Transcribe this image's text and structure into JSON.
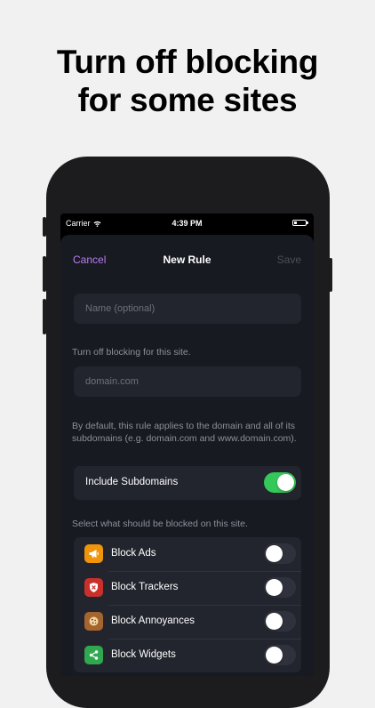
{
  "headline": {
    "line1": "Turn off blocking",
    "line2": "for some sites"
  },
  "statusbar": {
    "carrier": "Carrier",
    "time": "4:39 PM"
  },
  "navbar": {
    "cancel": "Cancel",
    "title": "New Rule",
    "save": "Save"
  },
  "name_field": {
    "placeholder": "Name (optional)"
  },
  "domain_section": {
    "label": "Turn off blocking for this site.",
    "placeholder": "domain.com",
    "explanation": "By default, this rule applies to the domain and all of its subdomains (e.g. domain.com and www.domain.com)."
  },
  "subdomains": {
    "label": "Include Subdomains",
    "enabled": true
  },
  "block_section": {
    "label": "Select what should be blocked on this site.",
    "items": [
      {
        "label": "Block Ads",
        "icon": "megaphone-icon",
        "color": "#f0940a",
        "enabled": false
      },
      {
        "label": "Block Trackers",
        "icon": "shield-icon",
        "color": "#c9302c",
        "enabled": false
      },
      {
        "label": "Block Annoyances",
        "icon": "cookie-icon",
        "color": "#a5652f",
        "enabled": false
      },
      {
        "label": "Block Widgets",
        "icon": "share-icon",
        "color": "#2fa84f",
        "enabled": false
      }
    ]
  },
  "colors": {
    "accent": "#b97df2",
    "toggle_on": "#34c759",
    "sheet_bg": "#181a22"
  }
}
